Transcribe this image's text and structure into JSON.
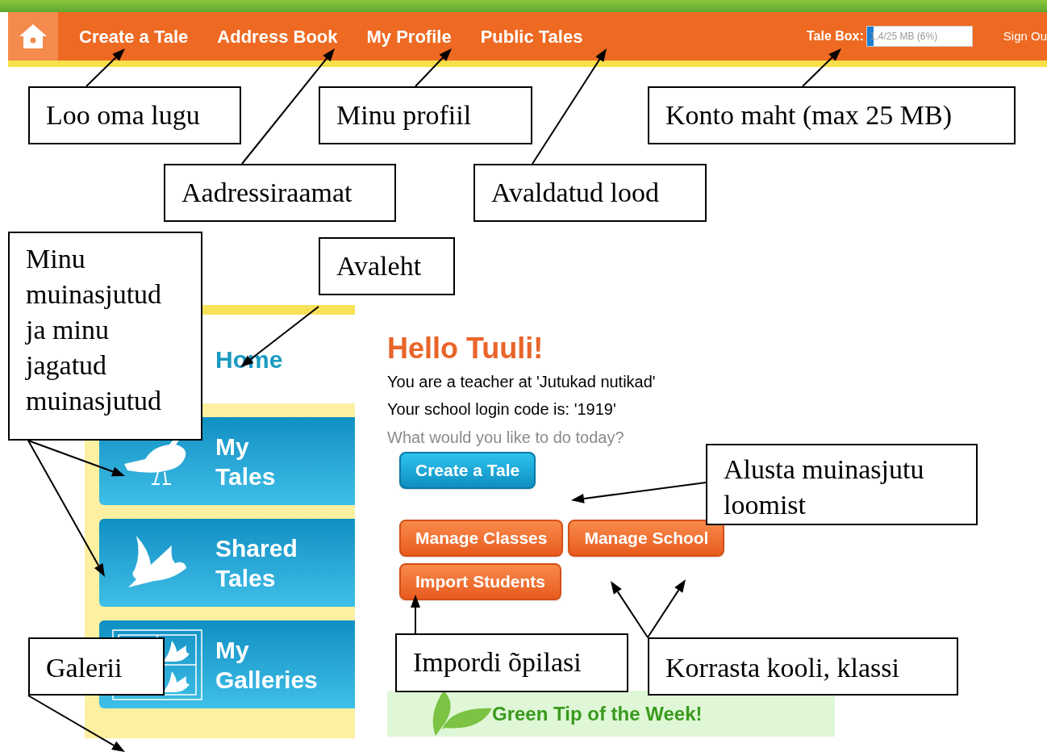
{
  "nav": {
    "items": [
      {
        "label": "Create a Tale"
      },
      {
        "label": "Address Book"
      },
      {
        "label": "My Profile"
      },
      {
        "label": "Public Tales"
      }
    ],
    "tale_box": {
      "label": "Tale Box:",
      "value": "1.4/25 MB (6%)",
      "level": 0.06
    },
    "sign_out": "Sign Ou"
  },
  "sidebar": {
    "home": "Home",
    "tiles": [
      {
        "kind": "perched",
        "label": "My Tales"
      },
      {
        "kind": "flying",
        "label": "Shared Tales"
      },
      {
        "kind": "gallery",
        "label": "My Galleries"
      }
    ]
  },
  "main": {
    "greeting": "Hello Tuuli!",
    "lines": [
      "You are a teacher at 'Jutukad nutikad'",
      "Your school login code is: '1919'"
    ],
    "prompt": "What would you like to do today?",
    "button_rows": [
      [
        {
          "kind": "primary",
          "label": "Create a Tale"
        }
      ],
      [
        {
          "kind": "secondary",
          "label": "Manage Classes"
        },
        {
          "kind": "secondary",
          "label": "Manage School"
        }
      ],
      [
        {
          "kind": "secondary",
          "label": "Import Students"
        }
      ]
    ],
    "green_tip": "Green Tip of the Week!"
  },
  "callouts": [
    "Loo oma lugu",
    "Aadressiraamat",
    "Minu profiil",
    "Avaldatud lood",
    "Konto maht (max 25 MB)",
    "Minu muinasjutud ja minu jagatud muinasjutud",
    "Avaleht",
    "Alusta muinasjutu loomist",
    "Galerii",
    "Impordi õpilasi",
    "Korrasta kooli, klassi"
  ]
}
